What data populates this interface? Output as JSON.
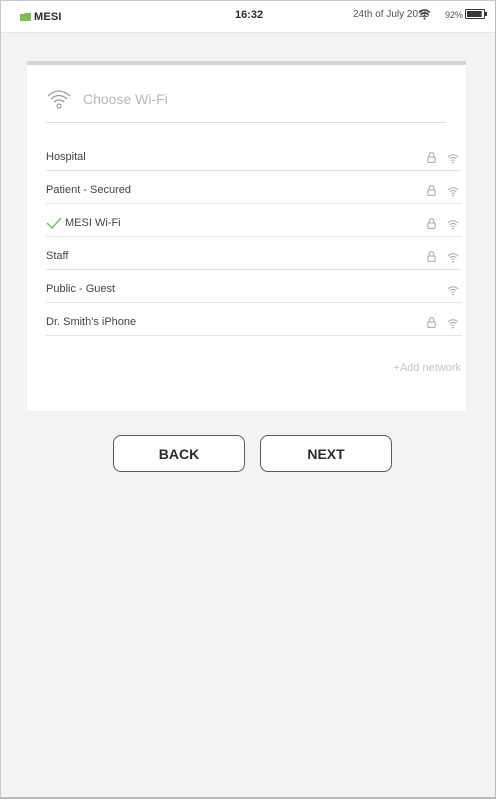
{
  "status_bar": {
    "carrier": "MESI",
    "time": "16:32",
    "date": "24th of July 2016",
    "battery_percent": "92%",
    "battery_level": 0.92
  },
  "card": {
    "title": "Choose Wi-Fi",
    "add_network_label": "+Add network"
  },
  "networks": [
    {
      "name": "Hospital",
      "secured": true,
      "connected": false
    },
    {
      "name": "Patient - Secured",
      "secured": true,
      "connected": false
    },
    {
      "name": "MESI Wi-Fi",
      "secured": true,
      "connected": true
    },
    {
      "name": "Staff",
      "secured": true,
      "connected": false
    },
    {
      "name": "Public - Guest",
      "secured": false,
      "connected": false
    },
    {
      "name": "Dr. Smith's iPhone",
      "secured": true,
      "connected": false
    }
  ],
  "buttons": {
    "back_label": "BACK",
    "next_label": "NEXT"
  },
  "colors": {
    "accent_green": "#7cc04b",
    "check_green": "#6dbf5a",
    "card_top_border": "#cfd7d2",
    "background": "#f2f3f2"
  }
}
